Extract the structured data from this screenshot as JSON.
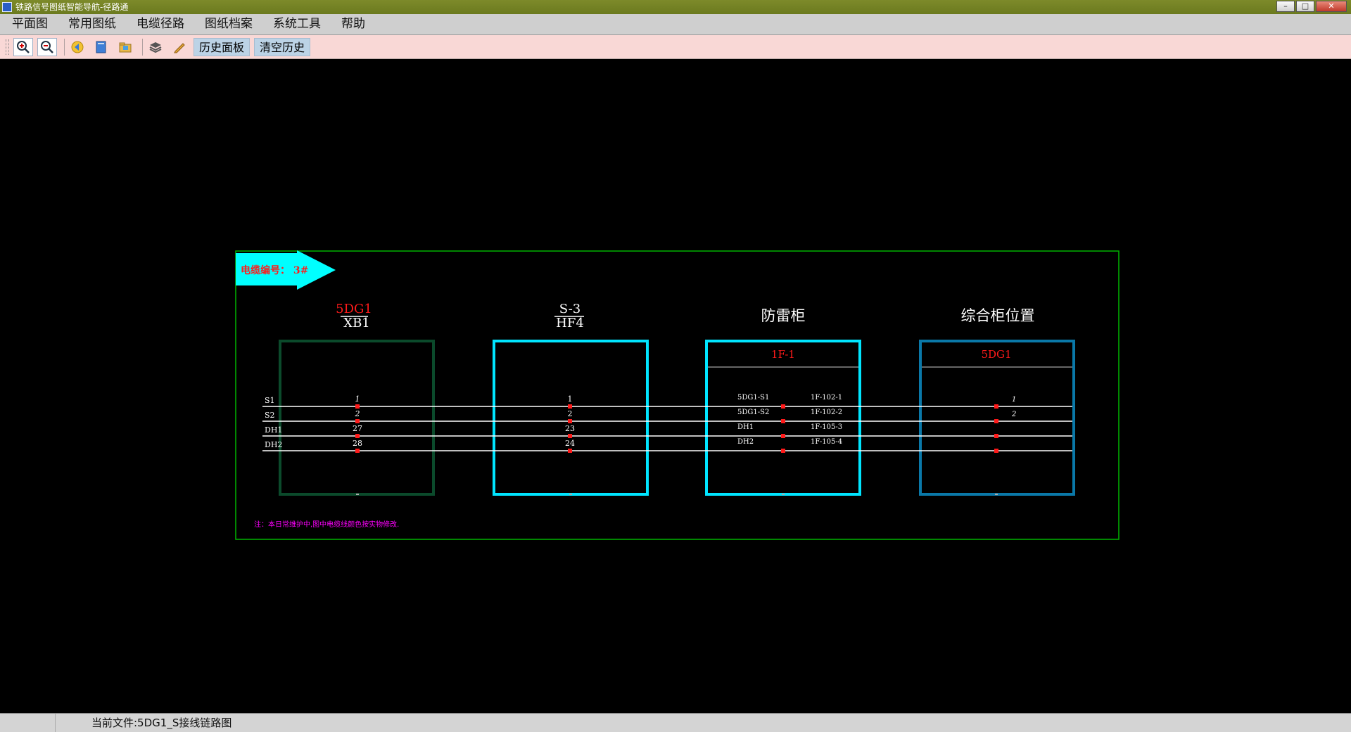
{
  "window": {
    "title": "铁路信号图纸智能导航-径路通",
    "buttons": {
      "minimize": "–",
      "maximize": "□",
      "close": "✕"
    }
  },
  "menu": [
    "平面图",
    "常用图纸",
    "电缆径路",
    "图纸档案",
    "系统工具",
    "帮助"
  ],
  "toolbar": {
    "icons": [
      "zoom-in-icon",
      "zoom-out-icon",
      "back-icon",
      "document-icon",
      "folder-icon",
      "layers-icon",
      "edit-icon"
    ],
    "history_panel": "历史面板",
    "clear_history": "清空历史"
  },
  "drawing": {
    "cable_label": "电缆编号： 3#",
    "colors": {
      "frame": "#00b400",
      "arrow": "#00ffff",
      "box1": "#0b4a2b",
      "box2": "#00e5ff",
      "box3": "#00e5ff",
      "box4": "#0a78a8",
      "red": "#ff1a1a",
      "note": "#ff00ff"
    },
    "boxes": [
      {
        "header_top": "5DG1",
        "header_bottom": "XB1",
        "inner_title": ""
      },
      {
        "header_top": "S-3",
        "header_bottom": "HF4",
        "inner_title": ""
      },
      {
        "header_top": "",
        "header_bottom": "防雷柜",
        "inner_title": "1F-1"
      },
      {
        "header_top": "",
        "header_bottom": "综合柜位置",
        "inner_title": "5DG1"
      }
    ],
    "wires": [
      {
        "name": "S1",
        "b1": "1",
        "b2": "1",
        "b3_left": "5DG1-S1",
        "b3_right": "1F-102-1",
        "b4": "1"
      },
      {
        "name": "S2",
        "b1": "2",
        "b2": "2",
        "b3_left": "5DG1-S2",
        "b3_right": "1F-102-2",
        "b4": "2"
      },
      {
        "name": "DH1",
        "b1": "27",
        "b2": "23",
        "b3_left": "DH1",
        "b3_right": "1F-105-3",
        "b4": ""
      },
      {
        "name": "DH2",
        "b1": "28",
        "b2": "24",
        "b3_left": "DH2",
        "b3_right": "1F-105-4",
        "b4": ""
      }
    ],
    "note": "注：本日常维护中,图中电缆线颜色按实物修改."
  },
  "status": {
    "current_file": "当前文件:5DG1_S接线链路图"
  }
}
